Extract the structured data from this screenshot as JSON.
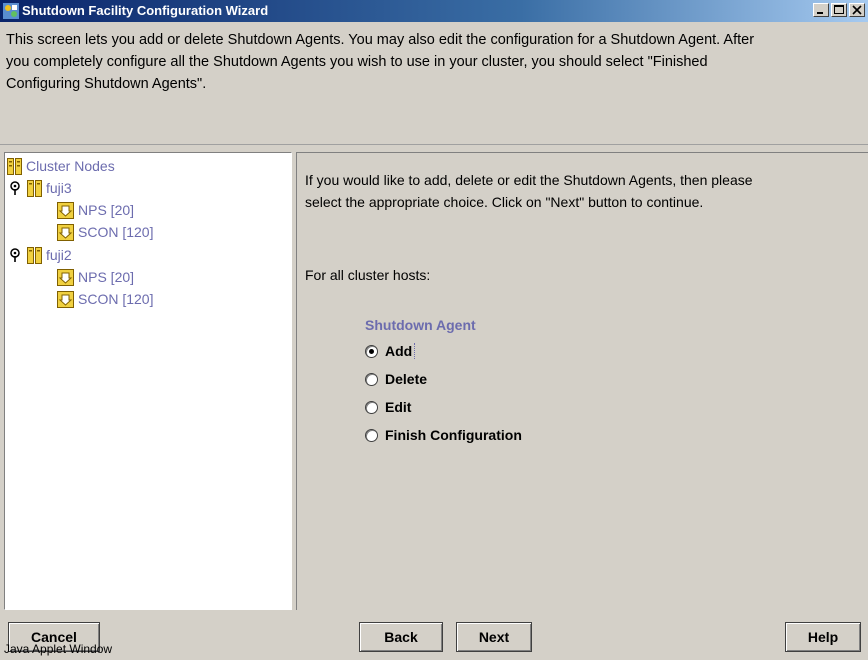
{
  "window": {
    "title": "Shutdown Facility Configuration Wizard",
    "controls": [
      "minimize-icon",
      "maximize-icon",
      "close-icon"
    ]
  },
  "description": {
    "line1": "This screen lets you add or delete Shutdown Agents. You may also edit the configuration for a Shutdown Agent. After",
    "line2": "you completely configure all the Shutdown Agents you wish to use in your cluster, you should select \"Finished",
    "line3": "Configuring Shutdown Agents\"."
  },
  "tree": {
    "root": "Cluster Nodes",
    "nodes": [
      {
        "name": "fuji3",
        "agents": [
          "NPS [20]",
          "SCON [120]"
        ]
      },
      {
        "name": "fuji2",
        "agents": [
          "NPS [20]",
          "SCON [120]"
        ]
      }
    ]
  },
  "right": {
    "instruction_line1": "If you would like to add, delete or edit the Shutdown Agents, then please",
    "instruction_line2": "select the appropriate choice. Click on \"Next\" button to continue.",
    "for_all": "For all cluster hosts:",
    "group_title": "Shutdown Agent",
    "options": [
      {
        "label": "Add",
        "selected": true
      },
      {
        "label": "Delete",
        "selected": false
      },
      {
        "label": "Edit",
        "selected": false
      },
      {
        "label": "Finish Configuration",
        "selected": false
      }
    ]
  },
  "buttons": {
    "cancel": "Cancel",
    "back": "Back",
    "next": "Next",
    "help": "Help"
  },
  "status": "Java Applet Window",
  "colors": {
    "titlebar_start": "#0a246a",
    "tree_text": "#6c6cae",
    "panel_bg": "#d4d0c8"
  }
}
